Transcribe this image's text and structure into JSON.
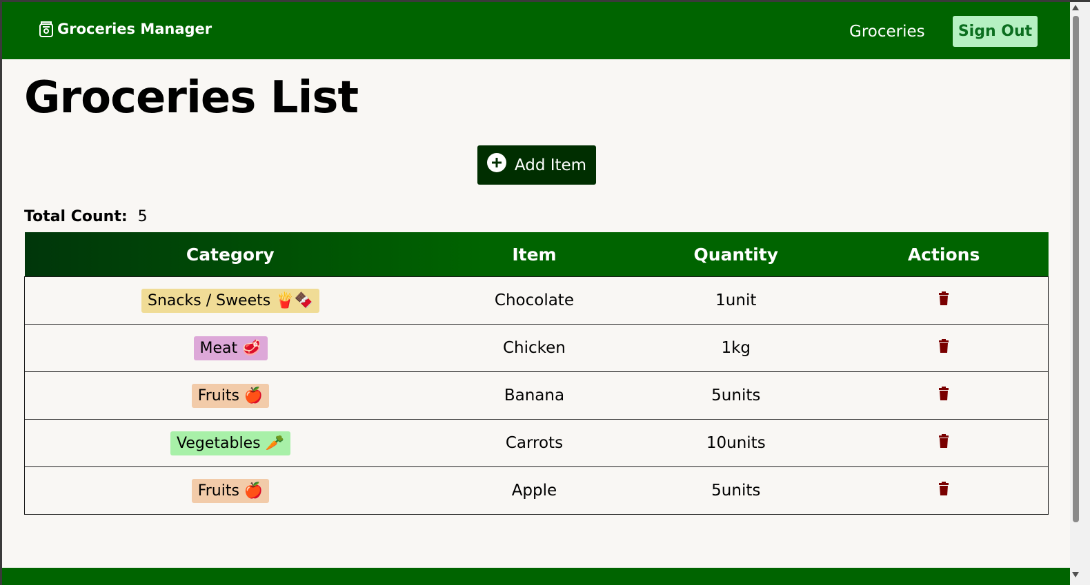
{
  "nav": {
    "brand": "Groceries Manager",
    "brand_icon": "grocery-bag-icon",
    "link": "Groceries",
    "sign_out": "Sign Out"
  },
  "page": {
    "title": "Groceries List",
    "add_item_label": "Add Item",
    "total_label": "Total Count:",
    "total_value": "5"
  },
  "table": {
    "headers": [
      "Category",
      "Item",
      "Quantity",
      "Actions"
    ],
    "rows": [
      {
        "category": "Snacks / Sweets 🍟🍫",
        "badge_color": "#f0dc96",
        "item": "Chocolate",
        "quantity": "1unit"
      },
      {
        "category": "Meat 🥩",
        "badge_color": "#dda8d8",
        "item": "Chicken",
        "quantity": "1kg"
      },
      {
        "category": "Fruits 🍎",
        "badge_color": "#f2cba9",
        "item": "Banana",
        "quantity": "5units"
      },
      {
        "category": "Vegetables 🥕",
        "badge_color": "#a8f0a8",
        "item": "Carrots",
        "quantity": "10units"
      },
      {
        "category": "Fruits 🍎",
        "badge_color": "#f2cba9",
        "item": "Apple",
        "quantity": "5units"
      }
    ]
  },
  "colors": {
    "primary": "#006400",
    "add_button": "#002e00",
    "sign_out_bg": "#b6f0c2",
    "trash": "#7a0000"
  }
}
